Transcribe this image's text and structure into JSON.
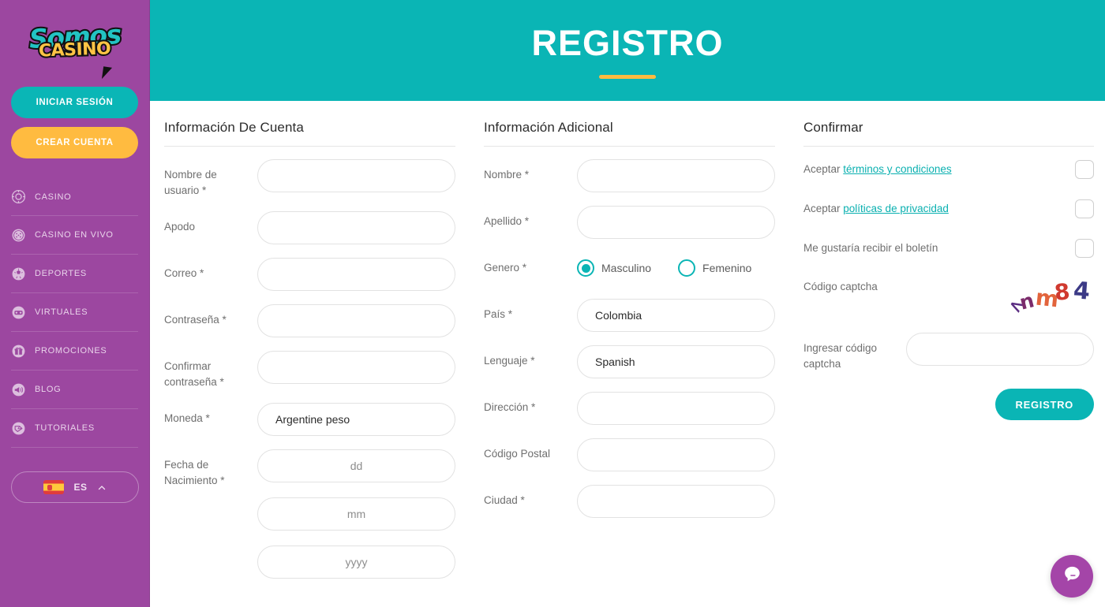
{
  "sidebar": {
    "logo": {
      "line1": "Somos",
      "line2": "CASINO"
    },
    "login_button": "INICIAR SESIÓN",
    "register_button": "CREAR CUENTA",
    "menu": [
      {
        "label": "CASINO",
        "icon": "casino-chip-icon"
      },
      {
        "label": "CASINO EN VIVO",
        "icon": "live-casino-icon"
      },
      {
        "label": "DEPORTES",
        "icon": "sports-ball-icon"
      },
      {
        "label": "VIRTUALES",
        "icon": "virtual-goggles-icon"
      },
      {
        "label": "PROMOCIONES",
        "icon": "gift-icon"
      },
      {
        "label": "BLOG",
        "icon": "megaphone-icon"
      },
      {
        "label": "TUTORIALES",
        "icon": "book-icon"
      }
    ],
    "language": {
      "code": "ES",
      "flag": "spain-flag-icon",
      "chevron": "chevron-up-icon"
    }
  },
  "hero": {
    "title": "REGISTRO"
  },
  "account_info": {
    "title": "Información De Cuenta",
    "fields": [
      {
        "label": "Nombre de usuario *",
        "value": "",
        "placeholder": ""
      },
      {
        "label": "Apodo",
        "value": "",
        "placeholder": ""
      },
      {
        "label": "Correo *",
        "value": "",
        "placeholder": ""
      },
      {
        "label": "Contraseña *",
        "value": "",
        "placeholder": ""
      },
      {
        "label": "Confirmar contraseña *",
        "value": "",
        "placeholder": ""
      },
      {
        "label": "Moneda *",
        "value": "Argentine peso",
        "placeholder": ""
      }
    ],
    "dob_label": "Fecha de Nacimiento *",
    "dob": [
      {
        "placeholder": "dd",
        "value": ""
      },
      {
        "placeholder": "mm",
        "value": ""
      },
      {
        "placeholder": "yyyy",
        "value": ""
      }
    ]
  },
  "additional_info": {
    "title": "Información Adicional",
    "fields": [
      {
        "label": "Nombre *",
        "value": ""
      },
      {
        "label": "Apellido *",
        "value": ""
      }
    ],
    "gender": {
      "label": "Genero *",
      "options": [
        {
          "label": "Masculino",
          "selected": true
        },
        {
          "label": "Femenino",
          "selected": false
        }
      ]
    },
    "fields2": [
      {
        "label": "País *",
        "value": "Colombia"
      },
      {
        "label": "Lenguaje *",
        "value": "Spanish"
      },
      {
        "label": "Dirección *",
        "value": ""
      },
      {
        "label": "Código Postal",
        "value": ""
      },
      {
        "label": "Ciudad *",
        "value": ""
      }
    ]
  },
  "confirm": {
    "title": "Confirmar",
    "checks": [
      {
        "prefix": "Aceptar ",
        "link": "términos y condiciones",
        "checked": false
      },
      {
        "prefix": "Aceptar ",
        "link": "políticas de privacidad",
        "checked": false
      },
      {
        "prefix": "Me gustaría recibir el boletín",
        "link": "",
        "checked": false
      }
    ],
    "captcha_label": "Código captcha",
    "captcha_chars": [
      "<",
      "n",
      "m",
      "8",
      "4"
    ],
    "captcha_input_label": "Ingresar código captcha",
    "captcha_input_value": "",
    "submit_label": "REGISTRO"
  },
  "chat": {
    "icon": "chat-bubble-icon"
  },
  "colors": {
    "purple": "#9c47a0",
    "teal": "#0ab5b5",
    "yellow": "#ffbb40",
    "link": "#0ab0b0"
  }
}
